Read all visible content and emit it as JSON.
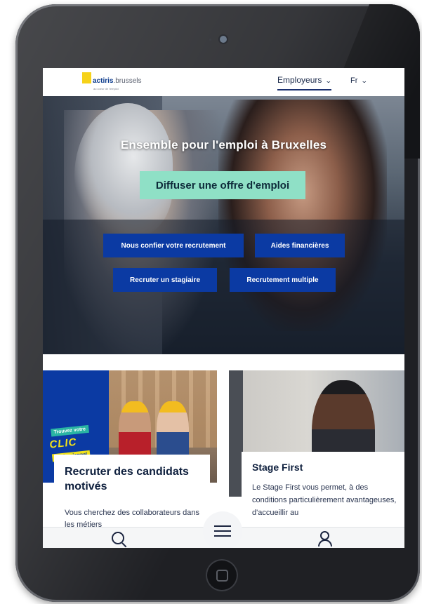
{
  "header": {
    "logo_name": "actiris",
    "logo_domain": ".brussels",
    "logo_tagline": "au coeur de l'emploi",
    "nav_employers": "Employeurs",
    "nav_lang": "Fr"
  },
  "hero": {
    "title": "Ensemble pour l'emploi à Bruxelles",
    "cta": "Diffuser une offre d'emploi",
    "buttons": [
      "Nous confier votre recrutement",
      "Aides financières",
      "Recruter un stagiaire",
      "Recrutement multiple"
    ]
  },
  "cards": [
    {
      "badge_top": "Trouvez votre",
      "badge_main": "CLIC",
      "badge_bottom": "professionnel",
      "title": "Recruter des candidats motivés",
      "text": "Vous cherchez des collaborateurs dans les métiers"
    },
    {
      "title": "Stage First",
      "text": "Le Stage First vous permet, à des conditions particulièrement avantageuses, d'accueillir au"
    }
  ],
  "bottom_nav": {
    "icons": [
      "search-icon",
      "menu-icon",
      "user-icon"
    ]
  },
  "colors": {
    "primary_blue": "#0b3aa3",
    "cta_mint": "#8fe0c6",
    "logo_yellow": "#f6d21a"
  }
}
